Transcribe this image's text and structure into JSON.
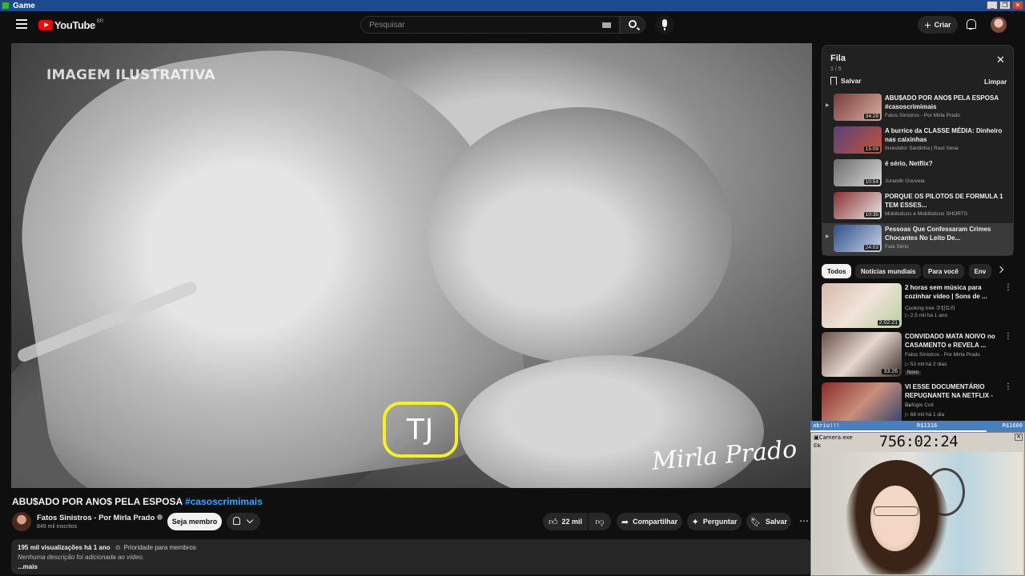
{
  "window": {
    "title": "Game",
    "buttons": [
      "_",
      "❐",
      "✕"
    ]
  },
  "header": {
    "logo_text": "YouTube",
    "country": "BR",
    "search_placeholder": "Pesquisar",
    "create_label": "Criar"
  },
  "video": {
    "overlay_label": "IMAGEM ILUSTRATIVA",
    "logo_text": "TJ",
    "signature": "Mirla Prado",
    "title": "ABU$ADO POR ANO$ PELA ESPOSA",
    "hashtag": "#casoscrimimais",
    "channel_name": "Fatos Sinistros - Por Mirla Prado",
    "channel_subs": "849 mil inscritos",
    "member_label": "Seja membro",
    "likes": "22 mil",
    "share_label": "Compartilhar",
    "ask_label": "Perguntar",
    "save_label": "Salvar",
    "views": "195 mil visualizações",
    "age": "há 1 ano",
    "priority": "Prioridade para membros",
    "no_description": "Nenhuma descrição foi adicionada ao vídeo.",
    "more": "...mais"
  },
  "queue": {
    "title": "Fila",
    "count": "1 / 5",
    "save_label": "Salvar",
    "clear_label": "Limpar",
    "items": [
      {
        "title": "ABU$ADO POR ANO$ PELA ESPOSA #casoscrimimais",
        "channel": "Fatos Sinistros - Por Mirla Prado",
        "duration": "34:29",
        "thumb": "#7a3a3a"
      },
      {
        "title": "A burrice da CLASSE MÉDIA: Dinheiro nas caixinhas",
        "channel": "Investidor Sardinha | Raul Sena",
        "duration": "15:09",
        "thumb": "#5a3f7a"
      },
      {
        "title": "é sério, Netflix?",
        "channel": "Jurandir Gouveia",
        "duration": "10:54",
        "thumb": "#6b6b6b"
      },
      {
        "title": "PORQUE OS PILOTOS DE FORMULA 1 TEM ESSES...",
        "channel": "Mobilisticos e Mobilisticos SHORTS",
        "duration": "10:35",
        "thumb": "#8a3030"
      },
      {
        "title": "Pessoas Que Confessaram Crimes Chocantes No Leito De...",
        "channel": "Fala Sério",
        "duration": "24:03",
        "thumb": "#2e4e8a"
      }
    ]
  },
  "chips": [
    "Todos",
    "Notícias mundiais",
    "Para você",
    "Env"
  ],
  "recommended": [
    {
      "title": "2 horas sem música para cozinhar vídeo | Sons de ...",
      "channel": "Cooking tree 쿠킹트리",
      "meta": "▷ 2,5 mil  há 1 ano",
      "duration": "2:02:21",
      "badge": "",
      "thumb": "#d6b7a8"
    },
    {
      "title": "CONVIDADO MATA NOIVO no CASAMENTO e REVELA ...",
      "channel": "Fatos Sinistros - Por Mirla Prado",
      "meta": "▷ 53 mil  há 2 dias",
      "duration": "33:26",
      "badge": "Novo",
      "thumb": "#6a5048"
    },
    {
      "title": "VI ESSE DOCUMENTÁRIO REPUGNANTE NA NETFLIX - ...",
      "channel": "Refúgio Cult",
      "meta": "▷ 68 mil  há 1 dia",
      "duration": "",
      "badge": "",
      "thumb": "#8a2a2a"
    }
  ],
  "overlay": {
    "donate_label": "abriu!!!",
    "donate_value": "R$1316",
    "donate_goal": "R$1600",
    "donate_progress": 0.82,
    "cam_title": "Camera.exe",
    "cam_menu": "Elk",
    "timer": "756:02:24"
  }
}
